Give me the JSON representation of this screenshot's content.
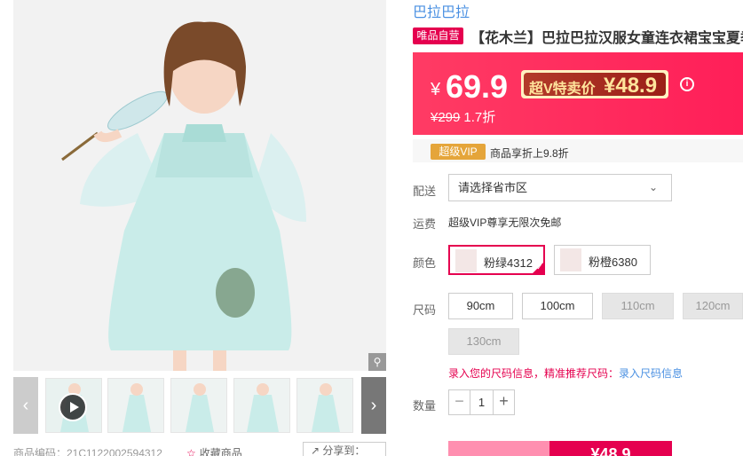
{
  "product_images": {
    "zoom_icon": "magnifier-icon",
    "thumb_prev_icon": "chevron-left-icon",
    "thumb_next_icon": "chevron-right-icon",
    "play_icon": "play-icon"
  },
  "meta": {
    "sku_code": "商品编码：21C1122002594312",
    "favorite": "收藏商品",
    "share": "分享到：",
    "favorite_icon": "star-icon",
    "share_icon": "share-icon"
  },
  "brand": "巴拉巴拉",
  "self_badge": "唯品自营",
  "title": "【花木兰】巴拉巴拉汉服女童连衣裙宝宝夏季",
  "price": {
    "currency": "¥",
    "current": "69.9",
    "vip_label": "超V特卖价",
    "vip_price": "¥48.9",
    "original": "¥299",
    "discount": "1.7折",
    "info_icon": "info-icon"
  },
  "vip_row": {
    "badge": "超级VIP",
    "text": "商品享折上9.8折"
  },
  "delivery": {
    "label": "配送",
    "select_value": "请选择省市区"
  },
  "shipping": {
    "label": "运费",
    "text": "超级VIP尊享无限次免邮"
  },
  "color": {
    "label": "颜色",
    "options": [
      "粉绿4312",
      "粉橙6380"
    ]
  },
  "size": {
    "label": "尺码",
    "options": [
      "90cm",
      "100cm",
      "110cm",
      "120cm",
      "130cm"
    ],
    "info_text": "录入您的尺码信息，精准推荐尺码：",
    "info_link": "录入尺码信息"
  },
  "quantity": {
    "label": "数量",
    "value": "1",
    "minus": "−",
    "plus": "+"
  },
  "buy": {
    "price_label": "¥48.9"
  },
  "colors": {
    "accent": "#e5004f",
    "link": "#4a90e2",
    "price_bg": "#ff2a5d",
    "vip_gold": "#e5a53a"
  }
}
